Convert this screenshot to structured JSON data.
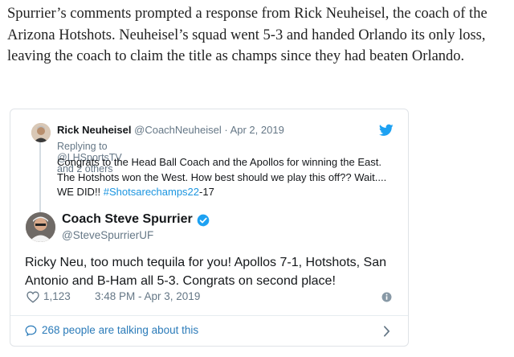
{
  "article": {
    "paragraph": "Spurrier’s comments prompted a response from Rick Neuheisel, the coach of the Arizona Hotshots. Neuheisel’s squad went 5-3 and handed Orlando its only loss, leaving the coach to claim the title as champs since they had beaten Orlando."
  },
  "reply_tweet": {
    "name": "Rick Neuheisel",
    "handle": "@CoachNeuheisel",
    "separator": "·",
    "date": "Apr 2, 2019",
    "replying_prefix": "Replying to",
    "replying_to": "@LHSportsTV",
    "replying_suffix": "and 2 others",
    "text": "Congrats to the Head Ball Coach and the Apollos for winning the East. The Hotshots won the West. How best should we play this off?? Wait.... WE DID!! ",
    "hashtag": "#Shotsarechamps22",
    "text_tail": "-17"
  },
  "main_tweet": {
    "name": "Coach Steve Spurrier",
    "handle": "@SteveSpurrierUF",
    "text": "Ricky Neu,  too much tequila for you!  Apollos 7-1, Hotshots, San Antonio and B-Ham all 5-3.  Congrats on second place!",
    "likes": "1,123",
    "timestamp": "3:48 PM - Apr 3, 2019"
  },
  "footer": {
    "talking": "268 people are talking about this"
  },
  "icons": {
    "bird": "twitter-bird-icon",
    "verified": "verified-badge-icon",
    "heart": "heart-icon",
    "info": "info-icon",
    "bubble": "speech-bubble-icon",
    "chevron": "chevron-right-icon"
  },
  "colors": {
    "twitter_blue": "#1da1f2",
    "link_blue": "#1b95e0",
    "gray_text": "#657786",
    "border": "#dfe3e7"
  }
}
